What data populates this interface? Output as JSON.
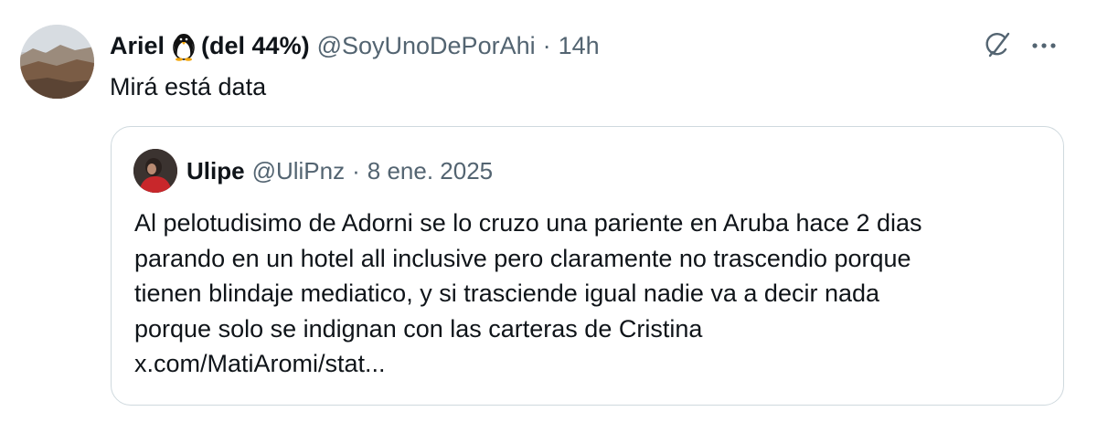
{
  "tweet": {
    "author": {
      "name": "Ariel",
      "name_suffix": "(del 44%)",
      "handle": "@SoyUnoDePorAhi",
      "separator": "·",
      "time": "14h"
    },
    "text": "Mirá está data",
    "icons": {
      "grok": "grok-icon",
      "more": "more-icon",
      "emoji": "penguin-icon"
    },
    "quote": {
      "author": {
        "name": "Ulipe",
        "handle": "@UliPnz",
        "separator": "·",
        "date": "8 ene. 2025"
      },
      "lines": [
        "Al pelotudisimo de Adorni se lo cruzo una pariente en Aruba hace 2 dias",
        "parando en un hotel all inclusive pero claramente no trascendio porque",
        "tienen blindaje mediatico, y si trasciende igual nadie va a decir nada",
        "porque solo se indignan con las carteras de Cristina",
        "x.com/MatiAromi/stat..."
      ]
    }
  },
  "colors": {
    "text_primary": "#0f1419",
    "text_secondary": "#536471",
    "border": "#cfd9de",
    "background": "#ffffff"
  }
}
